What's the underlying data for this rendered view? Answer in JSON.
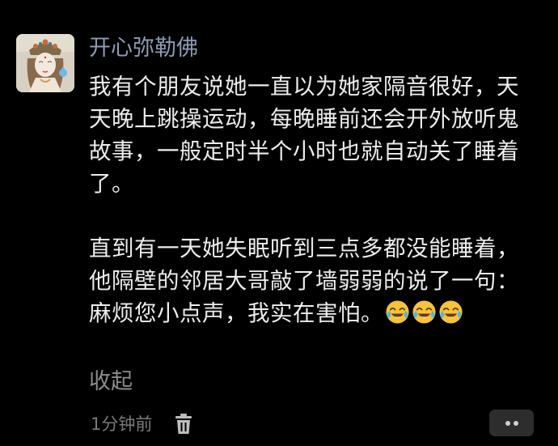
{
  "comment": {
    "author": "开心弥勒佛",
    "paragraph_1": "我有个朋友说她一直以为她家隔音很好，天天晚上跳操运动，每晚睡前还会开外放听鬼故事，一般定时半个小时也就自动关了睡着了。",
    "paragraph_2": "直到有一天她失眠听到三点多都没能睡着，他隔壁的邻居大哥敲了墙弱弱的说了一句：麻烦您小点声，我实在害怕。",
    "emojis": [
      "laugh-cry-emoji",
      "laugh-cry-emoji",
      "laugh-cry-emoji"
    ],
    "collapse_label": "收起",
    "timestamp": "1分钟前"
  },
  "icons": {
    "delete": "trash-icon",
    "more": "more-dots-icon"
  },
  "colors": {
    "background": "#000000",
    "author": "#8f9bb4",
    "text": "#ededed",
    "muted": "#8c8c8c",
    "more_button_bg": "#2d2d2d",
    "emoji_face": "#f6c33a"
  }
}
